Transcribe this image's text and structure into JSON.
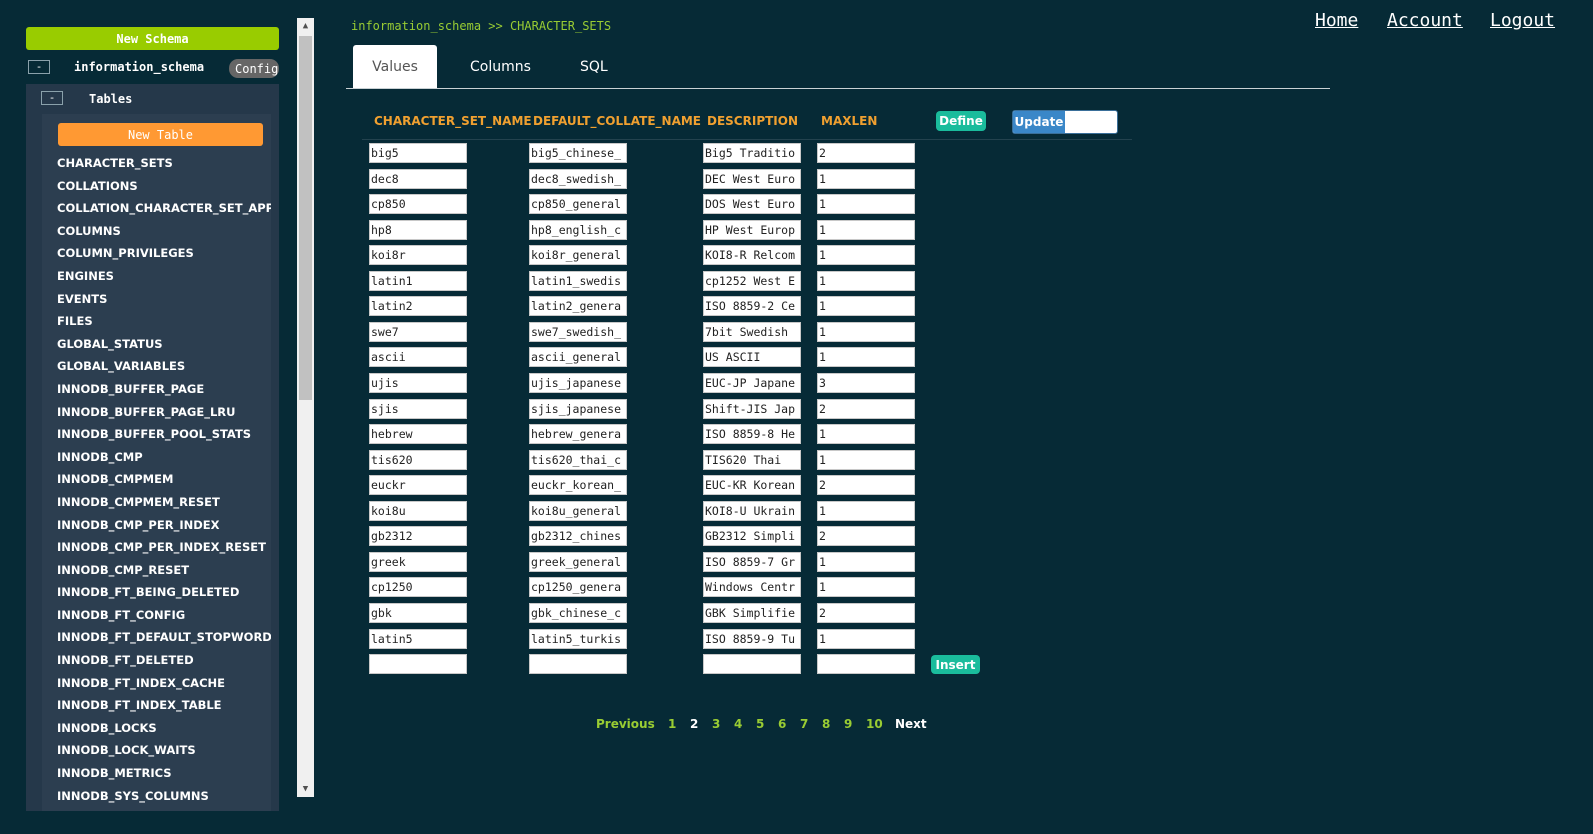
{
  "sidebar": {
    "new_schema_label": "New Schema",
    "schema_collapse": "-",
    "schema_name": "information_schema",
    "config_label": "Config",
    "tables_collapse": "-",
    "tables_label": "Tables",
    "new_table_label": "New Table",
    "tables": [
      "CHARACTER_SETS",
      "COLLATIONS",
      "COLLATION_CHARACTER_SET_APPLICABILITY",
      "COLUMNS",
      "COLUMN_PRIVILEGES",
      "ENGINES",
      "EVENTS",
      "FILES",
      "GLOBAL_STATUS",
      "GLOBAL_VARIABLES",
      "INNODB_BUFFER_PAGE",
      "INNODB_BUFFER_PAGE_LRU",
      "INNODB_BUFFER_POOL_STATS",
      "INNODB_CMP",
      "INNODB_CMPMEM",
      "INNODB_CMPMEM_RESET",
      "INNODB_CMP_PER_INDEX",
      "INNODB_CMP_PER_INDEX_RESET",
      "INNODB_CMP_RESET",
      "INNODB_FT_BEING_DELETED",
      "INNODB_FT_CONFIG",
      "INNODB_FT_DEFAULT_STOPWORD",
      "INNODB_FT_DELETED",
      "INNODB_FT_INDEX_CACHE",
      "INNODB_FT_INDEX_TABLE",
      "INNODB_LOCKS",
      "INNODB_LOCK_WAITS",
      "INNODB_METRICS",
      "INNODB_SYS_COLUMNS"
    ]
  },
  "scrollbar": {
    "up_arrow": "▲",
    "down_arrow": "▼"
  },
  "nav": {
    "home": "Home",
    "account": "Account",
    "logout": "Logout"
  },
  "breadcrumb": "information_schema >> CHARACTER_SETS",
  "tabs": {
    "values": "Values",
    "columns": "Columns",
    "sql": "SQL"
  },
  "table": {
    "columns": [
      "CHARACTER_SET_NAME",
      "DEFAULT_COLLATE_NAME",
      "DESCRIPTION",
      "MAXLEN"
    ],
    "define_label": "Define",
    "update_label": "Update",
    "update_value": "",
    "insert_label": "Insert",
    "rows": [
      [
        "big5",
        "big5_chinese_",
        "Big5 Traditio",
        "2"
      ],
      [
        "dec8",
        "dec8_swedish_",
        "DEC West Euro",
        "1"
      ],
      [
        "cp850",
        "cp850_general",
        "DOS West Euro",
        "1"
      ],
      [
        "hp8",
        "hp8_english_c",
        "HP West Europ",
        "1"
      ],
      [
        "koi8r",
        "koi8r_general",
        "KOI8-R Relcom",
        "1"
      ],
      [
        "latin1",
        "latin1_swedis",
        "cp1252 West E",
        "1"
      ],
      [
        "latin2",
        "latin2_genera",
        "ISO 8859-2 Ce",
        "1"
      ],
      [
        "swe7",
        "swe7_swedish_",
        "7bit Swedish",
        "1"
      ],
      [
        "ascii",
        "ascii_general",
        "US ASCII",
        "1"
      ],
      [
        "ujis",
        "ujis_japanese",
        "EUC-JP Japane",
        "3"
      ],
      [
        "sjis",
        "sjis_japanese",
        "Shift-JIS Jap",
        "2"
      ],
      [
        "hebrew",
        "hebrew_genera",
        "ISO 8859-8 He",
        "1"
      ],
      [
        "tis620",
        "tis620_thai_c",
        "TIS620 Thai",
        "1"
      ],
      [
        "euckr",
        "euckr_korean_",
        "EUC-KR Korean",
        "2"
      ],
      [
        "koi8u",
        "koi8u_general",
        "KOI8-U Ukrain",
        "1"
      ],
      [
        "gb2312",
        "gb2312_chines",
        "GB2312 Simpli",
        "2"
      ],
      [
        "greek",
        "greek_general",
        "ISO 8859-7 Gr",
        "1"
      ],
      [
        "cp1250",
        "cp1250_genera",
        "Windows Centr",
        "1"
      ],
      [
        "gbk",
        "gbk_chinese_c",
        "GBK Simplifie",
        "2"
      ],
      [
        "latin5",
        "latin5_turkis",
        "ISO 8859-9 Tu",
        "1"
      ]
    ]
  },
  "pagination": {
    "previous": "Previous",
    "pages": [
      "1",
      "2",
      "3",
      "4",
      "5",
      "6",
      "7",
      "8",
      "9",
      "10"
    ],
    "current": "2",
    "next": "Next"
  },
  "colors": {
    "background": "#062a36",
    "new_schema": "#99cc00",
    "new_table": "#ff9933",
    "header_text": "#f0a030",
    "accent_green": "#99cc33",
    "teal_button": "#1abc9c",
    "update_button": "#3a87c8"
  }
}
